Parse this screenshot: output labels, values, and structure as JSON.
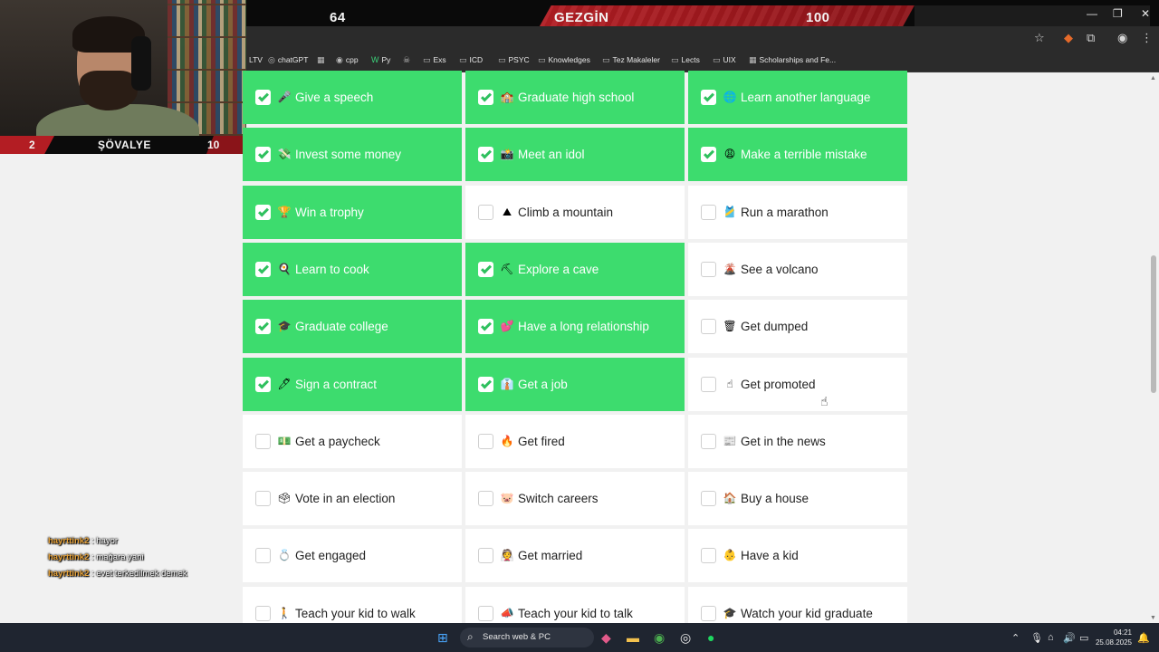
{
  "stream": {
    "left_score": "64",
    "title": "GEZGİN",
    "right_score": "100"
  },
  "webcam": {
    "left_num": "2",
    "title": "ŞÖVALYE",
    "right_num": "10"
  },
  "bookmarks": [
    {
      "icon": "",
      "label": "LTV"
    },
    {
      "icon": "◎",
      "label": "chatGPT"
    },
    {
      "icon": "▦",
      "label": ""
    },
    {
      "icon": "◉",
      "label": "cpp"
    },
    {
      "icon": "W",
      "label": "Py"
    },
    {
      "icon": "☠",
      "label": ""
    },
    {
      "icon": "▭",
      "label": "Exs"
    },
    {
      "icon": "▭",
      "label": "ICD"
    },
    {
      "icon": "▭",
      "label": "PSYC"
    },
    {
      "icon": "▭",
      "label": "Knowledges"
    },
    {
      "icon": "▭",
      "label": "Tez Makaleler"
    },
    {
      "icon": "▭",
      "label": "Lects"
    },
    {
      "icon": "▭",
      "label": "UIX"
    },
    {
      "icon": "▦",
      "label": "Scholarships and Fe..."
    }
  ],
  "cards": [
    {
      "emoji": "🎤",
      "label": "Give a speech",
      "checked": true
    },
    {
      "emoji": "🏫",
      "label": "Graduate high school",
      "checked": true
    },
    {
      "emoji": "🌐",
      "label": "Learn another language",
      "checked": true
    },
    {
      "emoji": "💸",
      "label": "Invest some money",
      "checked": true
    },
    {
      "emoji": "📸",
      "label": "Meet an idol",
      "checked": true
    },
    {
      "emoji": "😩",
      "label": "Make a terrible mistake",
      "checked": true
    },
    {
      "emoji": "🏆",
      "label": "Win a trophy",
      "checked": true
    },
    {
      "emoji": "⛰",
      "label": "Climb a mountain",
      "checked": false
    },
    {
      "emoji": "🎽",
      "label": "Run a marathon",
      "checked": false
    },
    {
      "emoji": "🍳",
      "label": "Learn to cook",
      "checked": true
    },
    {
      "emoji": "⛏",
      "label": "Explore a cave",
      "checked": true
    },
    {
      "emoji": "🌋",
      "label": "See a volcano",
      "checked": false
    },
    {
      "emoji": "🎓",
      "label": "Graduate college",
      "checked": true
    },
    {
      "emoji": "💕",
      "label": "Have a long relationship",
      "checked": true
    },
    {
      "emoji": "🗑",
      "label": "Get dumped",
      "checked": false
    },
    {
      "emoji": "🖊",
      "label": "Sign a contract",
      "checked": true
    },
    {
      "emoji": "👔",
      "label": "Get a job",
      "checked": true
    },
    {
      "emoji": "☝",
      "label": "Get promoted",
      "checked": false
    },
    {
      "emoji": "💵",
      "label": "Get a paycheck",
      "checked": false
    },
    {
      "emoji": "🔥",
      "label": "Get fired",
      "checked": false
    },
    {
      "emoji": "📰",
      "label": "Get in the news",
      "checked": false
    },
    {
      "emoji": "🗳",
      "label": "Vote in an election",
      "checked": false
    },
    {
      "emoji": "🐷",
      "label": "Switch careers",
      "checked": false
    },
    {
      "emoji": "🏠",
      "label": "Buy a house",
      "checked": false
    },
    {
      "emoji": "💍",
      "label": "Get engaged",
      "checked": false
    },
    {
      "emoji": "👰",
      "label": "Get married",
      "checked": false
    },
    {
      "emoji": "👶",
      "label": "Have a kid",
      "checked": false
    },
    {
      "emoji": "🚶",
      "label": "Teach your kid to walk",
      "checked": false
    },
    {
      "emoji": "📣",
      "label": "Teach your kid to talk",
      "checked": false
    },
    {
      "emoji": "🎓",
      "label": "Watch your kid graduate",
      "checked": false
    }
  ],
  "chat": [
    {
      "user": "hayrttink2",
      "message": ": hayor"
    },
    {
      "user": "hayrttink2",
      "message": ": mağara yani"
    },
    {
      "user": "hayrttink2",
      "message": ": evet terkedilmek demek"
    }
  ],
  "taskbar": {
    "search_placeholder": "Search web & PC",
    "time": "04:21",
    "date": "25.08.2025"
  },
  "colors": {
    "checked_card": "#3ddc6e",
    "unchecked_card": "#ffffff",
    "page_bg": "#f1f1f1",
    "stream_red": "#b31d23"
  }
}
